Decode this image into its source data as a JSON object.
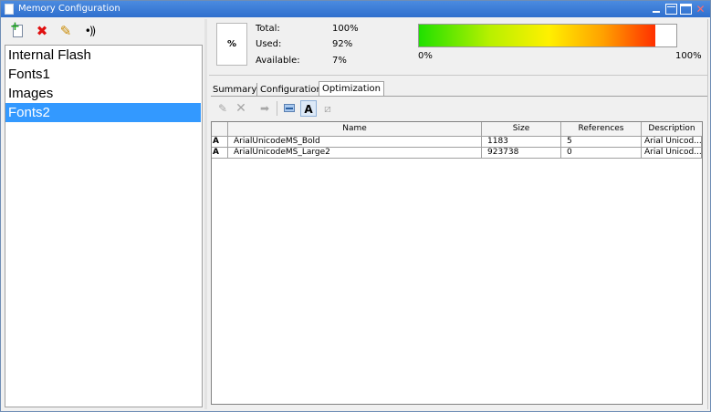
{
  "window": {
    "title": "Memory Configuration",
    "close_glyph": "✕"
  },
  "left_toolbar": {
    "add_icon": "add-page-icon",
    "delete_icon": "delete-x-icon",
    "delete_glyph": "✖",
    "edit_icon": "pencil-icon",
    "edit_glyph": "✎",
    "signal_icon": "signal-icon",
    "signal_glyph": "•))"
  },
  "memory_list": [
    "Internal Flash",
    "Fonts1",
    "Images",
    "Fonts2"
  ],
  "selected_memory": "Fonts2",
  "stats": {
    "percent_symbol": "%",
    "total_label": "Total:",
    "total_value": "100%",
    "used_label": "Used:",
    "used_value": "92%",
    "available_label": "Available:",
    "available_value": "7%",
    "bar_min_label": "0%",
    "bar_max_label": "100%",
    "used_fraction": 0.92
  },
  "tabs": [
    "Summary",
    "Configuration",
    "Optimization"
  ],
  "active_tab": "Optimization",
  "opt_toolbar": {
    "edit_glyph": "✎",
    "delete_glyph": "✕",
    "tag_glyph": "➡",
    "font_glyph": "A",
    "misc_glyph": "⧄"
  },
  "table": {
    "columns": [
      "",
      "Name",
      "Size",
      "References",
      "Description"
    ],
    "rows": [
      {
        "icon": "A",
        "name": "ArialUnicodeMS_Bold",
        "size": "1183",
        "references": "5",
        "description": "Arial Unicod..."
      },
      {
        "icon": "A",
        "name": "ArialUnicodeMS_Large2",
        "size": "923738",
        "references": "0",
        "description": "Arial Unicod..."
      }
    ]
  },
  "colors": {
    "titlebar": "#2f6fce",
    "selection": "#3399ff",
    "delete": "#e01010"
  }
}
